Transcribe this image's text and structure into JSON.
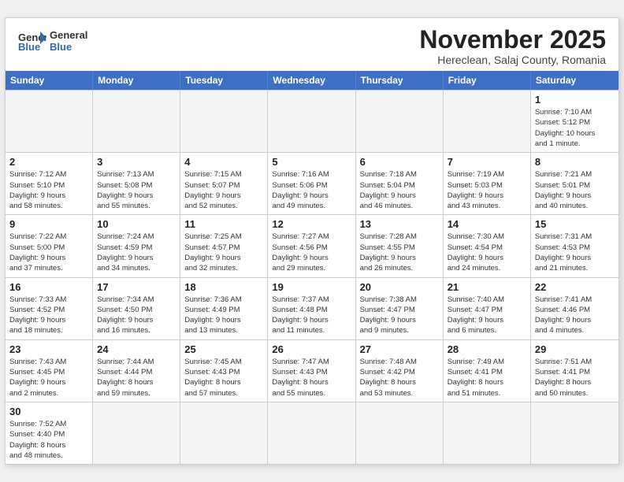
{
  "header": {
    "logo_general": "General",
    "logo_blue": "Blue",
    "month": "November 2025",
    "location": "Hereclean, Salaj County, Romania"
  },
  "days_of_week": [
    "Sunday",
    "Monday",
    "Tuesday",
    "Wednesday",
    "Thursday",
    "Friday",
    "Saturday"
  ],
  "cells": [
    {
      "day": "",
      "info": "",
      "empty": true
    },
    {
      "day": "",
      "info": "",
      "empty": true
    },
    {
      "day": "",
      "info": "",
      "empty": true
    },
    {
      "day": "",
      "info": "",
      "empty": true
    },
    {
      "day": "",
      "info": "",
      "empty": true
    },
    {
      "day": "",
      "info": "",
      "empty": true
    },
    {
      "day": "1",
      "info": "Sunrise: 7:10 AM\nSunset: 5:12 PM\nDaylight: 10 hours\nand 1 minute.",
      "empty": false
    },
    {
      "day": "2",
      "info": "Sunrise: 7:12 AM\nSunset: 5:10 PM\nDaylight: 9 hours\nand 58 minutes.",
      "empty": false
    },
    {
      "day": "3",
      "info": "Sunrise: 7:13 AM\nSunset: 5:08 PM\nDaylight: 9 hours\nand 55 minutes.",
      "empty": false
    },
    {
      "day": "4",
      "info": "Sunrise: 7:15 AM\nSunset: 5:07 PM\nDaylight: 9 hours\nand 52 minutes.",
      "empty": false
    },
    {
      "day": "5",
      "info": "Sunrise: 7:16 AM\nSunset: 5:06 PM\nDaylight: 9 hours\nand 49 minutes.",
      "empty": false
    },
    {
      "day": "6",
      "info": "Sunrise: 7:18 AM\nSunset: 5:04 PM\nDaylight: 9 hours\nand 46 minutes.",
      "empty": false
    },
    {
      "day": "7",
      "info": "Sunrise: 7:19 AM\nSunset: 5:03 PM\nDaylight: 9 hours\nand 43 minutes.",
      "empty": false
    },
    {
      "day": "8",
      "info": "Sunrise: 7:21 AM\nSunset: 5:01 PM\nDaylight: 9 hours\nand 40 minutes.",
      "empty": false
    },
    {
      "day": "9",
      "info": "Sunrise: 7:22 AM\nSunset: 5:00 PM\nDaylight: 9 hours\nand 37 minutes.",
      "empty": false
    },
    {
      "day": "10",
      "info": "Sunrise: 7:24 AM\nSunset: 4:59 PM\nDaylight: 9 hours\nand 34 minutes.",
      "empty": false
    },
    {
      "day": "11",
      "info": "Sunrise: 7:25 AM\nSunset: 4:57 PM\nDaylight: 9 hours\nand 32 minutes.",
      "empty": false
    },
    {
      "day": "12",
      "info": "Sunrise: 7:27 AM\nSunset: 4:56 PM\nDaylight: 9 hours\nand 29 minutes.",
      "empty": false
    },
    {
      "day": "13",
      "info": "Sunrise: 7:28 AM\nSunset: 4:55 PM\nDaylight: 9 hours\nand 26 minutes.",
      "empty": false
    },
    {
      "day": "14",
      "info": "Sunrise: 7:30 AM\nSunset: 4:54 PM\nDaylight: 9 hours\nand 24 minutes.",
      "empty": false
    },
    {
      "day": "15",
      "info": "Sunrise: 7:31 AM\nSunset: 4:53 PM\nDaylight: 9 hours\nand 21 minutes.",
      "empty": false
    },
    {
      "day": "16",
      "info": "Sunrise: 7:33 AM\nSunset: 4:52 PM\nDaylight: 9 hours\nand 18 minutes.",
      "empty": false
    },
    {
      "day": "17",
      "info": "Sunrise: 7:34 AM\nSunset: 4:50 PM\nDaylight: 9 hours\nand 16 minutes.",
      "empty": false
    },
    {
      "day": "18",
      "info": "Sunrise: 7:36 AM\nSunset: 4:49 PM\nDaylight: 9 hours\nand 13 minutes.",
      "empty": false
    },
    {
      "day": "19",
      "info": "Sunrise: 7:37 AM\nSunset: 4:48 PM\nDaylight: 9 hours\nand 11 minutes.",
      "empty": false
    },
    {
      "day": "20",
      "info": "Sunrise: 7:38 AM\nSunset: 4:47 PM\nDaylight: 9 hours\nand 9 minutes.",
      "empty": false
    },
    {
      "day": "21",
      "info": "Sunrise: 7:40 AM\nSunset: 4:47 PM\nDaylight: 9 hours\nand 6 minutes.",
      "empty": false
    },
    {
      "day": "22",
      "info": "Sunrise: 7:41 AM\nSunset: 4:46 PM\nDaylight: 9 hours\nand 4 minutes.",
      "empty": false
    },
    {
      "day": "23",
      "info": "Sunrise: 7:43 AM\nSunset: 4:45 PM\nDaylight: 9 hours\nand 2 minutes.",
      "empty": false
    },
    {
      "day": "24",
      "info": "Sunrise: 7:44 AM\nSunset: 4:44 PM\nDaylight: 8 hours\nand 59 minutes.",
      "empty": false
    },
    {
      "day": "25",
      "info": "Sunrise: 7:45 AM\nSunset: 4:43 PM\nDaylight: 8 hours\nand 57 minutes.",
      "empty": false
    },
    {
      "day": "26",
      "info": "Sunrise: 7:47 AM\nSunset: 4:43 PM\nDaylight: 8 hours\nand 55 minutes.",
      "empty": false
    },
    {
      "day": "27",
      "info": "Sunrise: 7:48 AM\nSunset: 4:42 PM\nDaylight: 8 hours\nand 53 minutes.",
      "empty": false
    },
    {
      "day": "28",
      "info": "Sunrise: 7:49 AM\nSunset: 4:41 PM\nDaylight: 8 hours\nand 51 minutes.",
      "empty": false
    },
    {
      "day": "29",
      "info": "Sunrise: 7:51 AM\nSunset: 4:41 PM\nDaylight: 8 hours\nand 50 minutes.",
      "empty": false
    },
    {
      "day": "30",
      "info": "Sunrise: 7:52 AM\nSunset: 4:40 PM\nDaylight: 8 hours\nand 48 minutes.",
      "empty": false
    },
    {
      "day": "",
      "info": "",
      "empty": true
    },
    {
      "day": "",
      "info": "",
      "empty": true
    },
    {
      "day": "",
      "info": "",
      "empty": true
    },
    {
      "day": "",
      "info": "",
      "empty": true
    },
    {
      "day": "",
      "info": "",
      "empty": true
    },
    {
      "day": "",
      "info": "",
      "empty": true
    }
  ]
}
